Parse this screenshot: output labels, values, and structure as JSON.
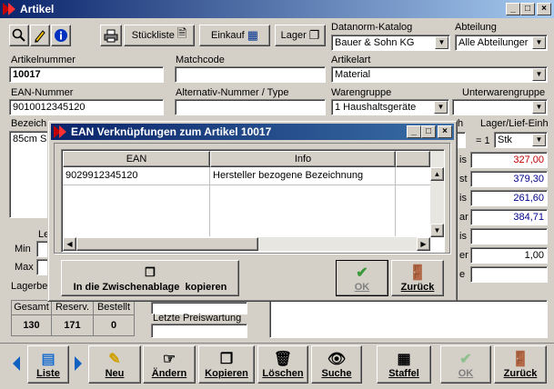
{
  "main_window": {
    "title": "Artikel",
    "toolbar": {
      "stueckliste_label": "Stückliste",
      "einkauf_label": "Einkauf",
      "lager_label": "Lager"
    },
    "fields": {
      "datanorm_label": "Datanorm-Katalog",
      "datanorm_value": "Bauer & Sohn KG",
      "abteilung_label": "Abteilung",
      "abteilung_value": "Alle Abteilunger",
      "artikelnummer_label": "Artikelnummer",
      "artikelnummer_value": "10017",
      "matchcode_label": "Matchcode",
      "matchcode_value": "",
      "artikelart_label": "Artikelart",
      "artikelart_value": "Material",
      "ean_label": "EAN-Nummer",
      "ean_value": "9010012345120",
      "altnr_label": "Alternativ-Nummer / Type",
      "altnr_value": "",
      "warengruppe_label": "Warengruppe",
      "warengruppe_value": "1 Haushaltsgeräte",
      "unterwarengruppe_label": "Unterwarengruppe",
      "bezeichnung_label": "Bezeich",
      "bezeichnung_value": "85cm S",
      "lager_lief_label": "Lager/Lief-Einh",
      "einheit_label": "h",
      "einheit_factor": "= 1",
      "einheit_value": "Stk",
      "min_label": "Min",
      "max_label": "Max",
      "le_label": "Le",
      "lagerbe_label": "Lagerbe",
      "letzte_preiswartung_label": "Letzte Preiswartung",
      "letzte_preiswartung_value": ""
    },
    "prices": [
      {
        "label": "is",
        "value": "327,00",
        "color": "#c00000"
      },
      {
        "label": "st",
        "value": "379,30",
        "color": "#00008b"
      },
      {
        "label": "is",
        "value": "261,60",
        "color": "#00008b"
      },
      {
        "label": "ar",
        "value": "384,71",
        "color": "#00008b"
      },
      {
        "label": "is",
        "value": "",
        "color": "#000000"
      },
      {
        "label": "er",
        "value": "1,00",
        "color": "#000000"
      },
      {
        "label": "e",
        "value": "",
        "color": "#000000"
      }
    ],
    "stock_table": {
      "headers": [
        "Gesamt",
        "Reserv.",
        "Bestellt"
      ],
      "values": [
        "130",
        "171",
        "0"
      ]
    },
    "bottom_buttons": {
      "liste": "Liste",
      "neu": "Neu",
      "aendern": "Ändern",
      "kopieren": "Kopieren",
      "loeschen": "Löschen",
      "suche": "Suche",
      "staffel": "Staffel",
      "ok": "OK",
      "zurueck": "Zurück"
    }
  },
  "dialog": {
    "title": "EAN Verknüpfungen zum Artikel 10017",
    "table": {
      "headers": [
        "EAN",
        "Info"
      ],
      "rows": [
        {
          "ean": "9029912345120",
          "info": "Hersteller bezogene Bezeichnung"
        }
      ]
    },
    "clipboard_button": "In die Zwischenablage  kopieren",
    "ok_button": "OK",
    "back_button": "Zurück"
  },
  "colors": {
    "title_active": "#0a246a",
    "title_gradient_end": "#3a6ea5",
    "window_bg": "#d4d0c8",
    "ok_check": "#3a9a3a"
  }
}
